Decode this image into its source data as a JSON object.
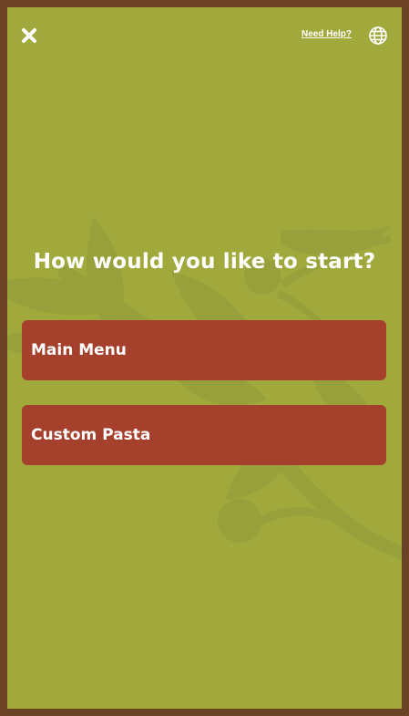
{
  "header": {
    "close_icon": "close-x-icon",
    "help_label": "Need Help?",
    "language_icon": "globe-icon"
  },
  "main": {
    "heading": "How would you like to start?",
    "options": [
      {
        "label": "Main Menu"
      },
      {
        "label": "Custom Pasta"
      }
    ]
  },
  "colors": {
    "background": "#a1a93c",
    "frame": "#6b4226",
    "button": "#a5402c",
    "text": "#ffffff"
  }
}
